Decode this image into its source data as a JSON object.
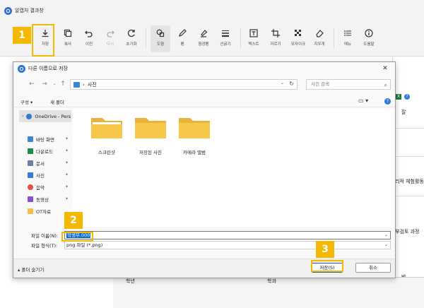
{
  "app": {
    "title": "알캡처 결과창"
  },
  "toolbar": {
    "items": [
      {
        "label": "저장",
        "icon": "download-icon"
      },
      {
        "label": "복사",
        "icon": "copy-icon"
      },
      {
        "label": "이전",
        "icon": "undo-icon"
      },
      {
        "label": "다시",
        "icon": "redo-icon"
      },
      {
        "label": "초기화",
        "icon": "reset-icon"
      },
      {
        "label": "도형",
        "icon": "shapes-icon"
      },
      {
        "label": "펜",
        "icon": "pen-icon"
      },
      {
        "label": "형광펜",
        "icon": "highlighter-icon"
      },
      {
        "label": "선굵기",
        "icon": "line-width-icon"
      },
      {
        "label": "텍스트",
        "icon": "text-icon"
      },
      {
        "label": "자르기",
        "icon": "crop-icon"
      },
      {
        "label": "모자이크",
        "icon": "mosaic-icon"
      },
      {
        "label": "지우개",
        "icon": "eraser-icon"
      },
      {
        "label": "메뉴",
        "icon": "menu-icon"
      },
      {
        "label": "도움말",
        "icon": "help-icon"
      }
    ]
  },
  "background": {
    "right_texts": [
      "잘",
      "리적 체험활동",
      "부검토 과정",
      "반"
    ],
    "table_headers": [
      "학년",
      "학과"
    ]
  },
  "dialog": {
    "title": "다른 이름으로 저장",
    "address_path": "사진",
    "search_placeholder": "사진 검색",
    "commands": {
      "organize": "구성 ▾",
      "new_folder": "새 폴더"
    },
    "nav_items": [
      {
        "label": "OneDrive - Pers",
        "color": "#2f7bd6"
      },
      {
        "label": "바탕 화면",
        "color": "#3d86d6"
      },
      {
        "label": "다운로드",
        "color": "#1d8a4a"
      },
      {
        "label": "문서",
        "color": "#6d7fa3"
      },
      {
        "label": "사진",
        "color": "#2f7bd6"
      },
      {
        "label": "음악",
        "color": "#e0523a"
      },
      {
        "label": "동영상",
        "color": "#8a4fd0"
      },
      {
        "label": "OT자료",
        "color": "#f0c243"
      }
    ],
    "folders": [
      "스크린샷",
      "저장된 사진",
      "카메라 앨범"
    ],
    "filename_label": "파일 이름(N):",
    "filename_value": "학생부.000",
    "filetype_label": "파일 형식(T):",
    "filetype_value": "png 파일 (*.png)",
    "hide_folders": "폴더 숨기기",
    "save_button": "저장(S)",
    "cancel_button": "취소"
  },
  "annotations": [
    "1",
    "2",
    "3"
  ],
  "colors": {
    "highlight": "#f5b800",
    "selection": "#0a6ad6",
    "folder": "#f6c94a"
  }
}
